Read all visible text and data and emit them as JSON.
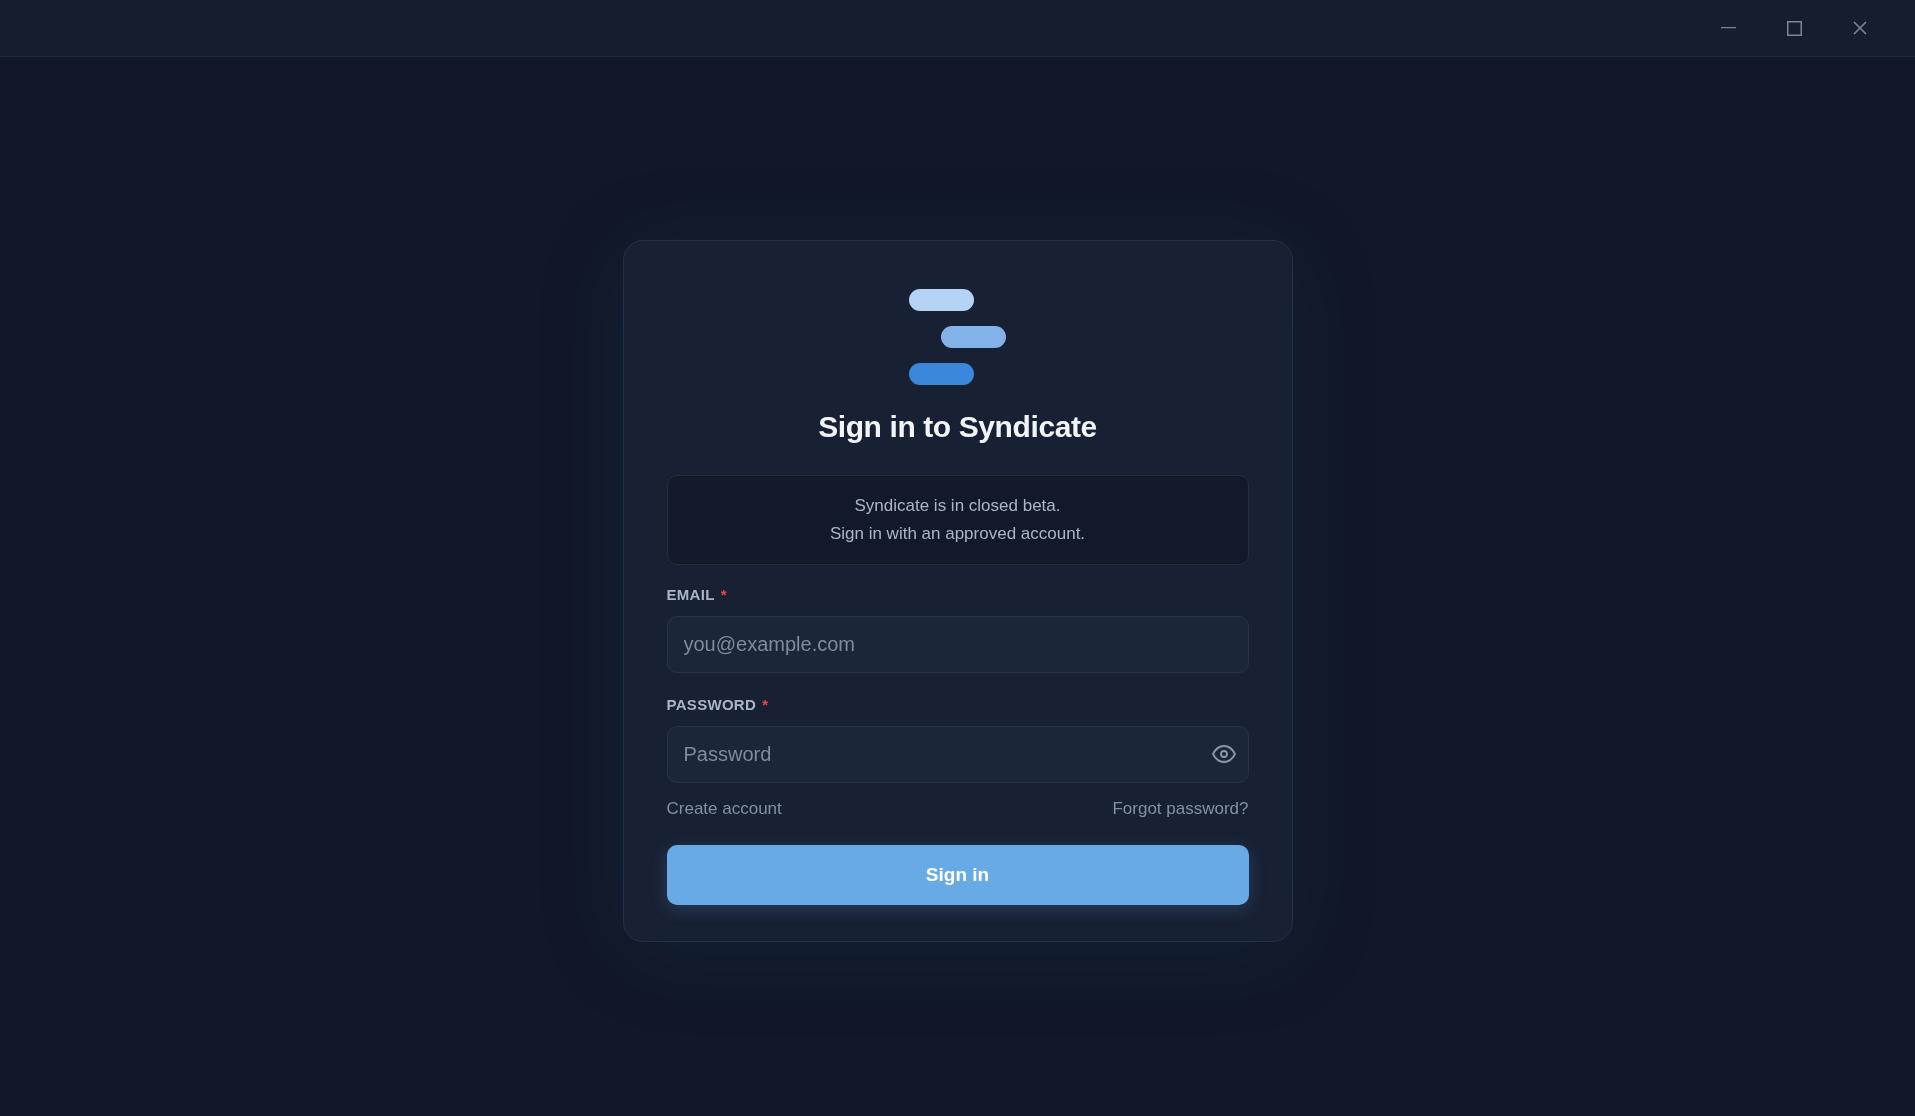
{
  "title": "Sign in to Syndicate",
  "notice": {
    "lines": [
      "Syndicate is in closed beta.",
      "Sign in with an approved account."
    ]
  },
  "fields": [
    {
      "kind": "email",
      "label": "EMAIL",
      "required_mark": "*",
      "placeholder": "you@example.com"
    },
    {
      "kind": "password",
      "label": "PASSWORD",
      "required_mark": "*",
      "placeholder": "Password"
    }
  ],
  "links": [
    {
      "label": "Create account"
    },
    {
      "label": "Forgot password?"
    }
  ],
  "submit": {
    "label": "Sign in"
  }
}
